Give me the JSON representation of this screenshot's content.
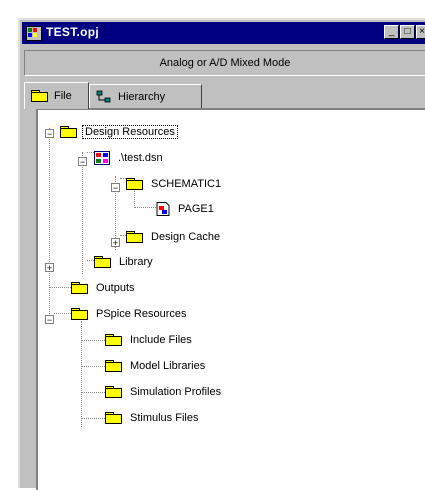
{
  "window": {
    "title": "TEST.opj"
  },
  "modebar": {
    "text": "Analog or A/D Mixed Mode"
  },
  "tabs": [
    {
      "label": "File",
      "icon": "folder-icon"
    },
    {
      "label": "Hierarchy",
      "icon": "hierarchy-icon"
    }
  ],
  "tree": {
    "design_resources": "Design Resources",
    "dsn": ".\\test.dsn",
    "schematic": "SCHEMATIC1",
    "page": "PAGE1",
    "design_cache": "Design Cache",
    "library": "Library",
    "outputs": "Outputs",
    "pspice_resources": "PSpice Resources",
    "include_files": "Include Files",
    "model_libraries": "Model Libraries",
    "simulation_profiles": "Simulation Profiles",
    "stimulus_files": "Stimulus Files"
  },
  "colors": {
    "titlebar": "#000080",
    "folder": "#ffff00",
    "window": "#c0c0c0"
  }
}
